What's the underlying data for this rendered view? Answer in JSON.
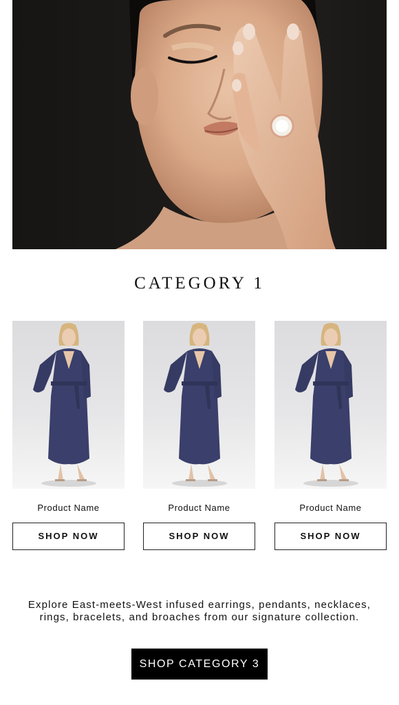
{
  "hero": {
    "icon": "hero-portrait-image"
  },
  "category": {
    "title": "CATEGORY 1"
  },
  "products": [
    {
      "name": "Product Name",
      "button_label": "SHOP NOW",
      "image": "robe-model-photo"
    },
    {
      "name": "Product Name",
      "button_label": "SHOP NOW",
      "image": "robe-model-photo"
    },
    {
      "name": "Product Name",
      "button_label": "SHOP NOW",
      "image": "robe-model-photo"
    }
  ],
  "description": "Explore East-meets-West infused earrings, pendants, necklaces, rings, bracelets, and broaches from our signature collection.",
  "cta": {
    "label": "SHOP CATEGORY 3"
  },
  "colors": {
    "cta_background": "#000000",
    "cta_text": "#ffffff",
    "robe": "#3a3f6b",
    "hero_background": "#1c1a18"
  }
}
